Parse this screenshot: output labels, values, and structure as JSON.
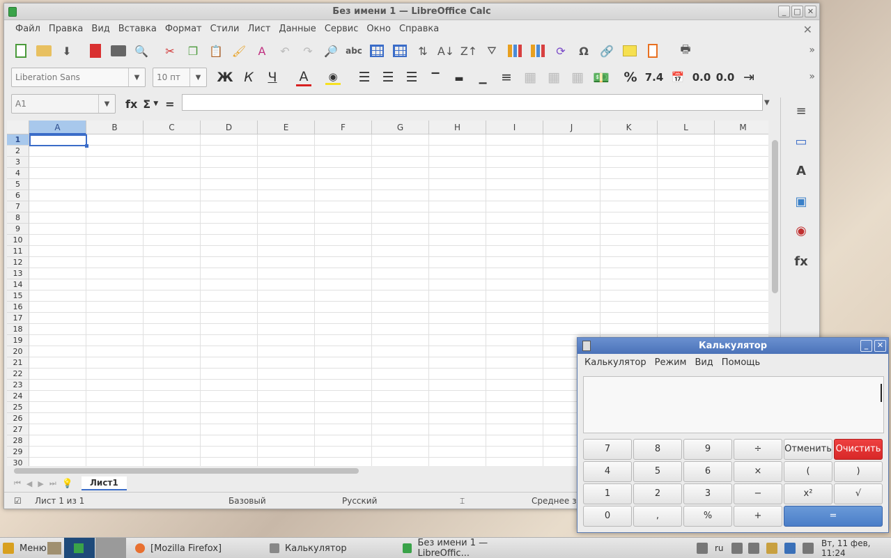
{
  "lo": {
    "title": "Без имени 1 — LibreOffice Calc",
    "win_buttons": [
      "_",
      "□",
      "✕"
    ],
    "menu": [
      "Файл",
      "Правка",
      "Вид",
      "Вставка",
      "Формат",
      "Стили",
      "Лист",
      "Данные",
      "Сервис",
      "Окно",
      "Справка"
    ],
    "close_doc": "✕",
    "font_name": "Liberation Sans",
    "font_size": "10 пт",
    "bold": "Ж",
    "italic": "К",
    "underline": "Ч",
    "font_color": "A",
    "percent": "%",
    "number_fmt": "7.4",
    "add_decimal": "0.0",
    "del_decimal": "0.0",
    "name_box": "A1",
    "fx": "fx",
    "sigma": "Σ",
    "equals": "=",
    "columns": [
      "A",
      "B",
      "C",
      "D",
      "E",
      "F",
      "G",
      "H",
      "I",
      "J",
      "K",
      "L",
      "M"
    ],
    "rows": [
      "1",
      "2",
      "3",
      "4",
      "5",
      "6",
      "7",
      "8",
      "9",
      "10",
      "11",
      "12",
      "13",
      "14",
      "15",
      "16",
      "17",
      "18",
      "19",
      "20",
      "21",
      "22",
      "23",
      "24",
      "25",
      "26",
      "27",
      "28",
      "29",
      "30"
    ],
    "sheet_tab": "Лист1",
    "status": {
      "sheet": "Лист 1 из 1",
      "style": "Базовый",
      "lang": "Русский",
      "sum": "Среднее зн"
    }
  },
  "calc": {
    "title": "Калькулятор",
    "menu": [
      "Калькулятор",
      "Режим",
      "Вид",
      "Помощь"
    ],
    "keys": [
      [
        "7",
        "8",
        "9",
        "÷",
        "Отменить",
        "Очистить"
      ],
      [
        "4",
        "5",
        "6",
        "×",
        "(",
        ")"
      ],
      [
        "1",
        "2",
        "3",
        "−",
        "x²",
        "√"
      ],
      [
        "0",
        ",",
        "%",
        "+",
        "="
      ]
    ]
  },
  "taskbar": {
    "menu_label": "Меню",
    "tasks": [
      "[Mozilla Firefox]",
      "Калькулятор",
      "Без имени 1 — LibreOffic..."
    ],
    "lang": "ru",
    "clock": "Вт, 11 фев, 11:24"
  }
}
